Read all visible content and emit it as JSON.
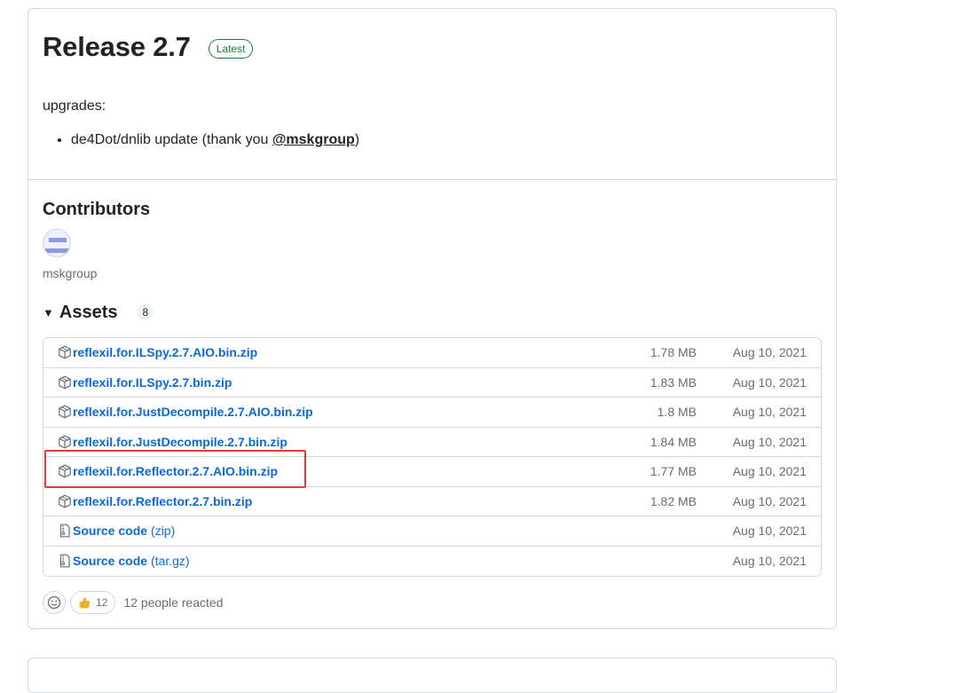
{
  "release": {
    "title": "Release 2.7",
    "badge": "Latest",
    "intro": "upgrades:",
    "notes": [
      {
        "text": "de4Dot/dnlib update (thank you ",
        "mention": "@mskgroup",
        "suffix": ")"
      }
    ]
  },
  "contributors": {
    "title": "Contributors",
    "names": [
      "mskgroup"
    ]
  },
  "assets": {
    "title": "Assets",
    "count": "8",
    "rows": [
      {
        "name": "reflexil.for.ILSpy.2.7.AIO.bin.zip",
        "size": "1.78 MB",
        "date": "Aug 10, 2021",
        "icon": "package-icon"
      },
      {
        "name": "reflexil.for.ILSpy.2.7.bin.zip",
        "size": "1.83 MB",
        "date": "Aug 10, 2021",
        "icon": "package-icon"
      },
      {
        "name": "reflexil.for.JustDecompile.2.7.AIO.bin.zip",
        "size": "1.8 MB",
        "date": "Aug 10, 2021",
        "icon": "package-icon"
      },
      {
        "name": "reflexil.for.JustDecompile.2.7.bin.zip",
        "size": "1.84 MB",
        "date": "Aug 10, 2021",
        "icon": "package-icon"
      },
      {
        "name": "reflexil.for.Reflector.2.7.AIO.bin.zip",
        "size": "1.77 MB",
        "date": "Aug 10, 2021",
        "icon": "package-icon"
      },
      {
        "name": "reflexil.for.Reflector.2.7.bin.zip",
        "size": "1.82 MB",
        "date": "Aug 10, 2021",
        "icon": "package-icon"
      },
      {
        "name": "Source code",
        "ext": "(zip)",
        "size": "",
        "date": "Aug 10, 2021",
        "icon": "file-zip-icon"
      },
      {
        "name": "Source code",
        "ext": "(tar.gz)",
        "size": "",
        "date": "Aug 10, 2021",
        "icon": "file-zip-icon"
      }
    ]
  },
  "reactions": {
    "thumbs_up_count": "12",
    "summary": "12 people reacted"
  },
  "colors": {
    "link": "#0969da",
    "badge_green": "#1a7f37",
    "highlight_red": "#e53935",
    "border": "#d0d7de"
  }
}
